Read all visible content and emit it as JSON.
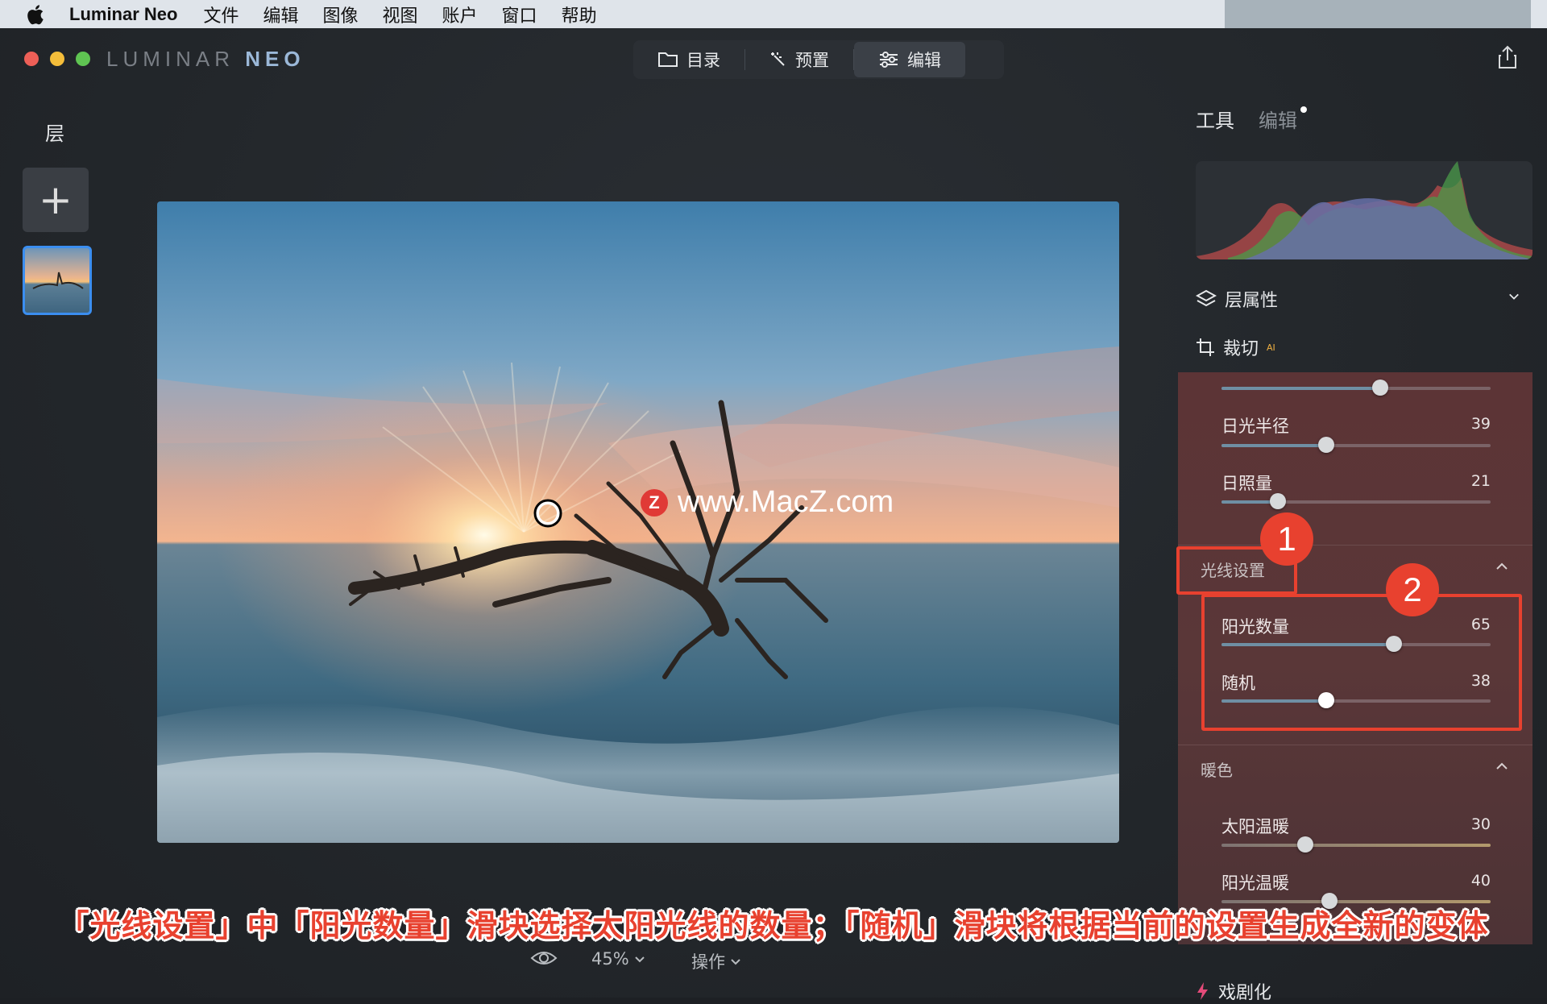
{
  "menubar": {
    "app_name": "Luminar Neo",
    "items": [
      "文件",
      "编辑",
      "图像",
      "视图",
      "账户",
      "窗口",
      "帮助"
    ]
  },
  "window": {
    "logo_part1": "LUMINAR",
    "logo_part2": "NEO",
    "tabs": [
      {
        "label": "目录",
        "icon": "folder-icon"
      },
      {
        "label": "预置",
        "icon": "sparkle-wand-icon"
      },
      {
        "label": "编辑",
        "icon": "sliders-icon"
      }
    ],
    "active_tab": "编辑"
  },
  "layers": {
    "title": "层",
    "add_label": "+"
  },
  "right_panel": {
    "tab_tools": "工具",
    "tab_edits": "编辑",
    "layer_properties": "层属性",
    "crop": "裁切",
    "crop_badge": "AI",
    "sliders_top": [
      {
        "label": "日光半径",
        "value": 39
      },
      {
        "label": "日照量",
        "value": 21
      }
    ],
    "section_rays": "光线设置",
    "sliders_rays": [
      {
        "label": "阳光数量",
        "value": 65
      },
      {
        "label": "随机",
        "value": 38
      }
    ],
    "section_warmth": "暖色",
    "sliders_warmth": [
      {
        "label": "太阳温暖",
        "value": 30
      },
      {
        "label": "阳光温暖",
        "value": 40
      }
    ],
    "drama": "戏剧化"
  },
  "annotations": {
    "badge1": "1",
    "badge2": "2",
    "caption": "「光线设置」中「阳光数量」滑块选择太阳光线的数量；「随机」滑块将根据当前的设置生成全新的变体"
  },
  "watermark": {
    "badge": "Z",
    "text": "www.MacZ.com"
  },
  "bottom": {
    "zoom": "45%",
    "actions": "操作"
  },
  "colors": {
    "accent_blue": "#3b8ef0",
    "annotation_red": "#e8412f",
    "panel_bg": "#5a3738"
  }
}
